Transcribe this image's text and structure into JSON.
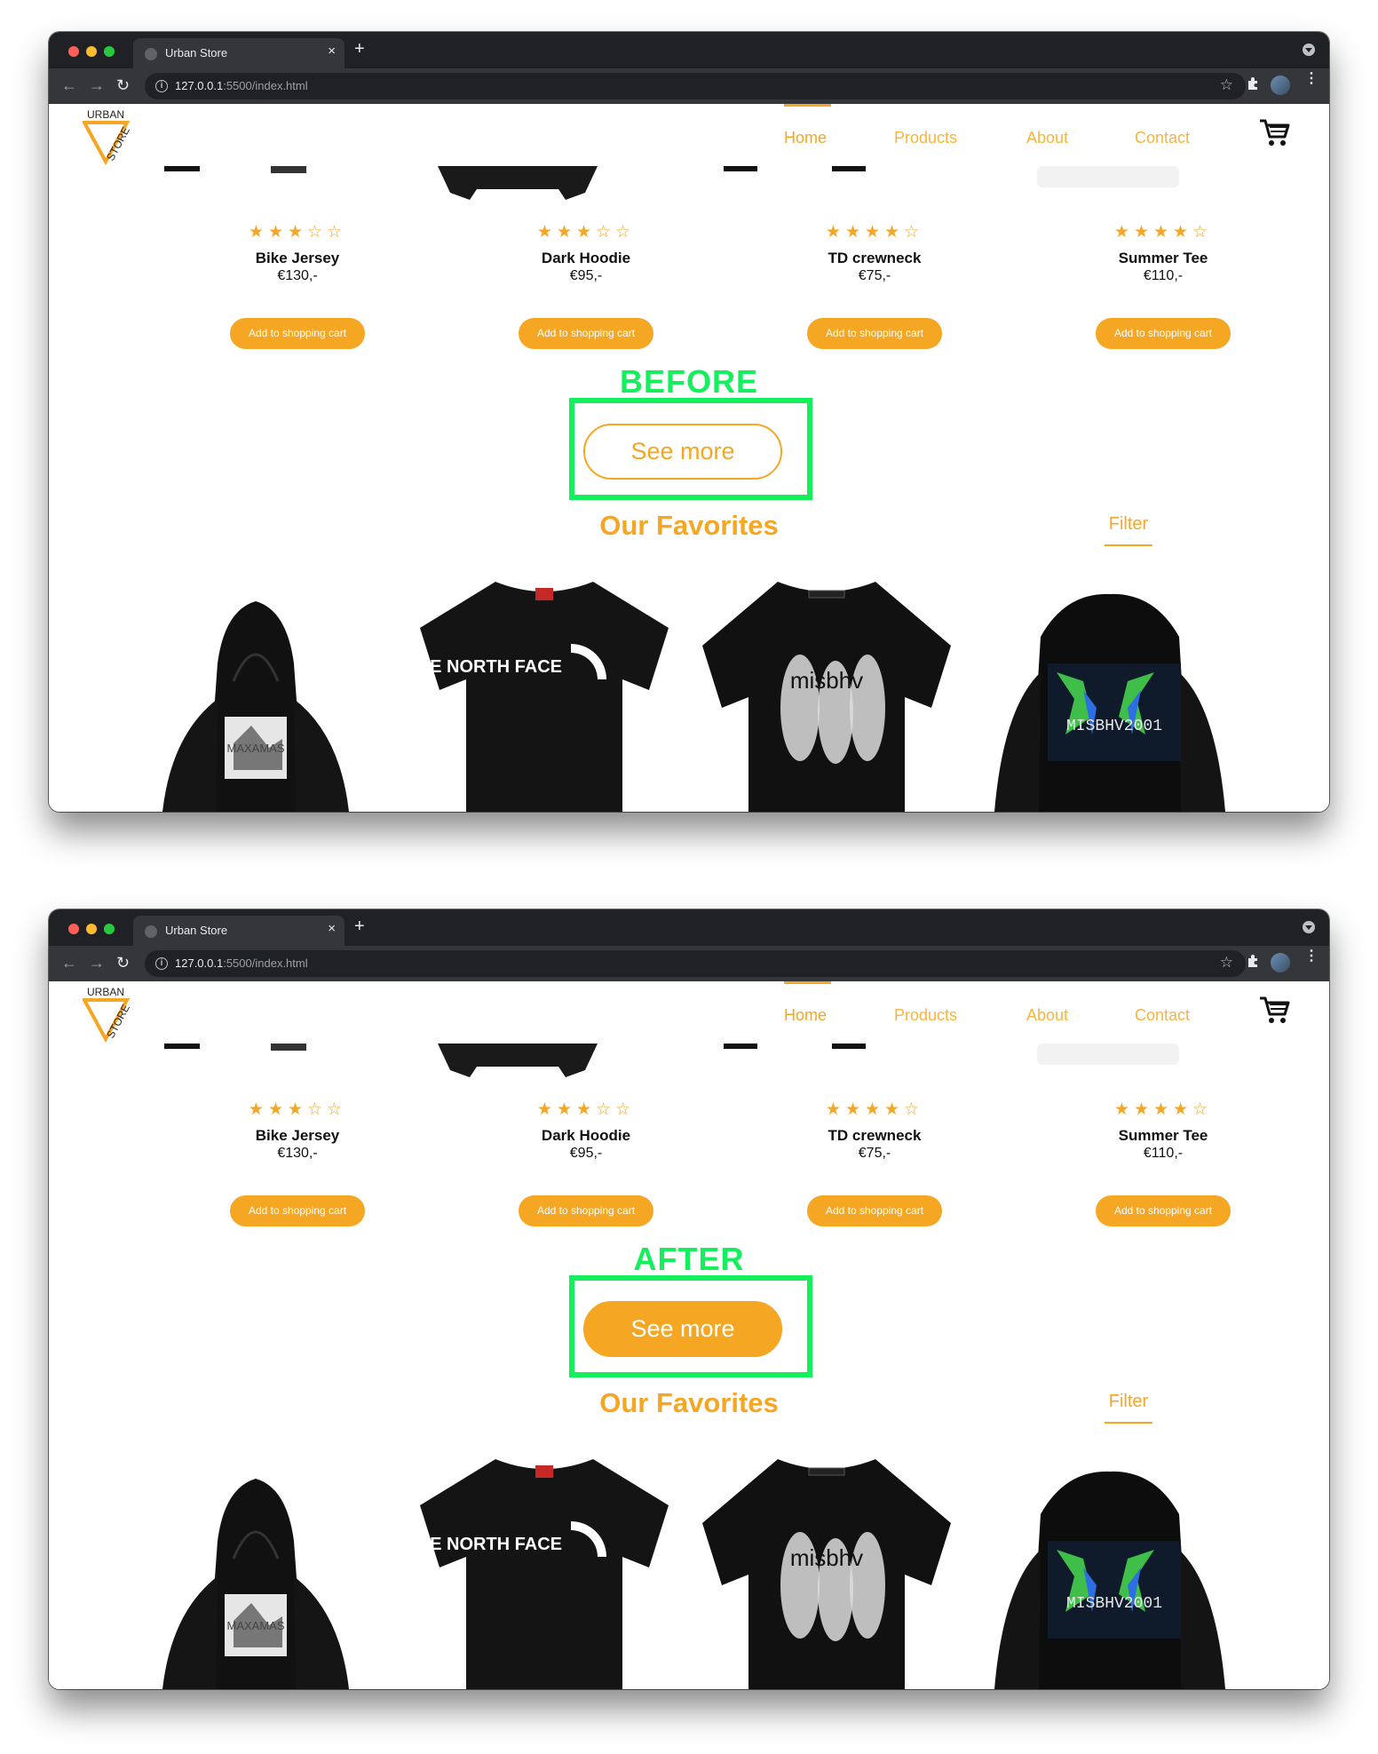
{
  "browser": {
    "tab_title": "Urban Store",
    "tab_close": "×",
    "new_tab": "+",
    "url_host": "127.0.0.1",
    "url_path": ":5500/index.html",
    "back": "←",
    "forward": "→",
    "reload": "↻",
    "info": "i",
    "bookmark": "☆",
    "menu": "⋮"
  },
  "site": {
    "logo_word_top": "URBAN",
    "logo_word_side": "STORE",
    "nav": [
      {
        "label": "Home",
        "active": true
      },
      {
        "label": "Products",
        "active": false
      },
      {
        "label": "About",
        "active": false
      },
      {
        "label": "Contact",
        "active": false
      }
    ]
  },
  "products": [
    {
      "name": "Bike Jersey",
      "price": "€130,-",
      "stars": "★★★☆☆",
      "rating": 3,
      "button": "Add to shopping cart"
    },
    {
      "name": "Dark Hoodie",
      "price": "€95,-",
      "stars": "★★★☆☆",
      "rating": 3,
      "button": "Add to shopping cart"
    },
    {
      "name": "TD crewneck",
      "price": "€75,-",
      "stars": "★★★★☆",
      "rating": 4,
      "button": "Add to shopping cart"
    },
    {
      "name": "Summer Tee",
      "price": "€110,-",
      "stars": "★★★★☆",
      "rating": 4,
      "button": "Add to shopping cart"
    }
  ],
  "comparison": {
    "before_label": "BEFORE",
    "after_label": "AFTER",
    "button_label": "See more",
    "highlight_color": "#14f05c"
  },
  "favorites": {
    "title": "Our Favorites",
    "filter": "Filter",
    "items": [
      {
        "graphic_text": "MAXAMAS"
      },
      {
        "graphic_text": "THE NORTH FACE"
      },
      {
        "graphic_text": "misbhv"
      },
      {
        "graphic_text": "MISBHV2001"
      }
    ]
  },
  "colors": {
    "accent": "#f5a623",
    "chrome_dark": "#202124",
    "chrome_toolbar": "#35363a"
  },
  "icons": [
    "shopping-cart-icon",
    "star-icon",
    "reload-icon",
    "info-icon",
    "puzzle-extension-icon",
    "profile-avatar-icon",
    "kebab-menu-icon"
  ]
}
